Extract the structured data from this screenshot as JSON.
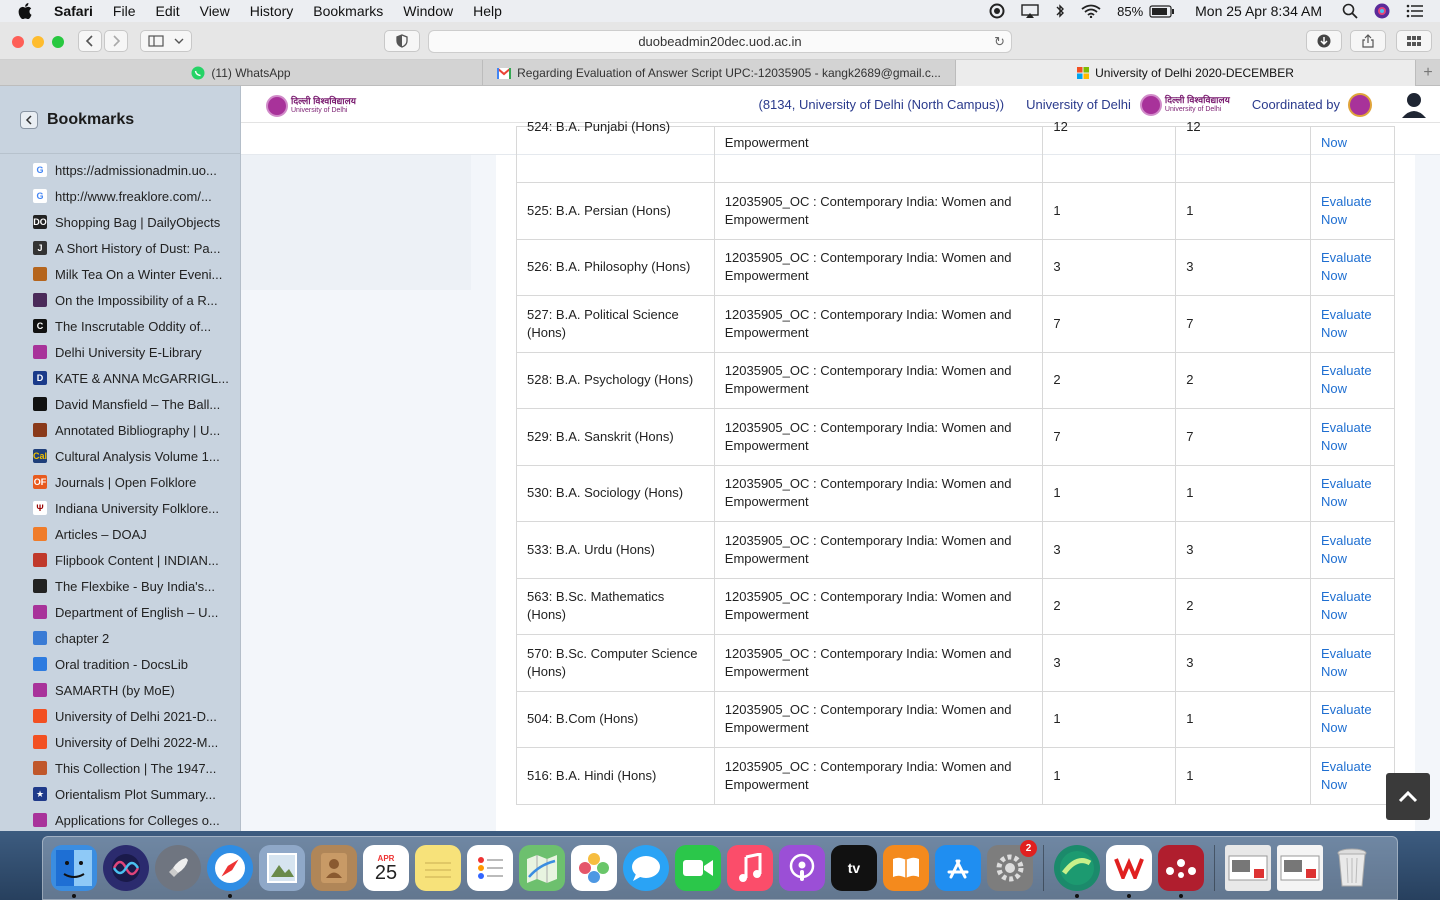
{
  "menubar": {
    "app": "Safari",
    "items": [
      "File",
      "Edit",
      "View",
      "History",
      "Bookmarks",
      "Window",
      "Help"
    ],
    "battery": "85%",
    "datetime": "Mon 25 Apr  8:34 AM"
  },
  "toolbar": {
    "url": "duobeadmin20dec.uod.ac.in"
  },
  "tabs": [
    {
      "label": "(11) WhatsApp",
      "icon": "whatsapp-icon"
    },
    {
      "label": "Regarding Evaluation of Answer Script UPC:-12035905 - kangk2689@gmail.c...",
      "icon": "gmail-icon"
    },
    {
      "label": "University of Delhi 2020-DECEMBER",
      "icon": "microsoft-icon"
    }
  ],
  "sidebar": {
    "title": "Bookmarks",
    "items": [
      {
        "label": "https://admissionadmin.uo...",
        "fav": "G",
        "color": "#ffffff",
        "fg": "#4285f4"
      },
      {
        "label": "http://www.freaklore.com/...",
        "fav": "G",
        "color": "#ffffff",
        "fg": "#4285f4"
      },
      {
        "label": "Shopping Bag | DailyObjects",
        "fav": "DO",
        "color": "#222222",
        "fg": "#ffffff"
      },
      {
        "label": "A Short History of Dust: Pa...",
        "fav": "J",
        "color": "#333333",
        "fg": "#ffffff"
      },
      {
        "label": "Milk Tea On a Winter Eveni...",
        "fav": "",
        "color": "#b5651d",
        "fg": "#ffffff"
      },
      {
        "label": "On the Impossibility of a R...",
        "fav": "",
        "color": "#4a2a5a",
        "fg": "#ffffff"
      },
      {
        "label": "The Inscrutable Oddity of...",
        "fav": "C",
        "color": "#111111",
        "fg": "#ffffff"
      },
      {
        "label": "Delhi University E-Library",
        "fav": "",
        "color": "#a8329a",
        "fg": "#ffffff"
      },
      {
        "label": "KATE & ANNA McGARRIGL...",
        "fav": "D",
        "color": "#1a3a8a",
        "fg": "#ffffff"
      },
      {
        "label": "David Mansfield – The Ball...",
        "fav": "",
        "color": "#111111",
        "fg": "#ffffff"
      },
      {
        "label": "Annotated Bibliography | U...",
        "fav": "",
        "color": "#8a3a1a",
        "fg": "#ffffff"
      },
      {
        "label": "Cultural Analysis Volume 1...",
        "fav": "Cal",
        "color": "#1f3f7a",
        "fg": "#f2c200"
      },
      {
        "label": "Journals | Open Folklore",
        "fav": "OF",
        "color": "#e85a1e",
        "fg": "#ffffff"
      },
      {
        "label": "Indiana University Folklore...",
        "fav": "Ψ",
        "color": "#ffffff",
        "fg": "#990000"
      },
      {
        "label": "Articles – DOAJ",
        "fav": "",
        "color": "#f07c2a",
        "fg": "#ffffff"
      },
      {
        "label": "Flipbook Content | INDIAN...",
        "fav": "",
        "color": "#c0392b",
        "fg": "#ffffff"
      },
      {
        "label": "The Flexbike - Buy India's...",
        "fav": "",
        "color": "#222222",
        "fg": "#ffffff"
      },
      {
        "label": "Department of English – U...",
        "fav": "",
        "color": "#a8329a",
        "fg": "#ffffff"
      },
      {
        "label": "chapter 2",
        "fav": "",
        "color": "#3a7bd5",
        "fg": "#ffffff"
      },
      {
        "label": "Oral tradition - DocsLib",
        "fav": "",
        "color": "#2d7be0",
        "fg": "#ffffff"
      },
      {
        "label": "SAMARTH (by MoE)",
        "fav": "",
        "color": "#a8329a",
        "fg": "#ffffff"
      },
      {
        "label": "University of Delhi 2021-D...",
        "fav": "",
        "color": "#f25022",
        "fg": "#ffffff"
      },
      {
        "label": "University of Delhi 2022-M...",
        "fav": "",
        "color": "#f25022",
        "fg": "#ffffff"
      },
      {
        "label": "This Collection | The 1947...",
        "fav": "",
        "color": "#c0572b",
        "fg": "#ffffff"
      },
      {
        "label": "Orientalism Plot Summary...",
        "fav": "★",
        "color": "#1f3a8a",
        "fg": "#ffffff"
      },
      {
        "label": "Applications for Colleges o...",
        "fav": "",
        "color": "#a8329a",
        "fg": "#ffffff"
      }
    ]
  },
  "header": {
    "logo_hi": "दिल्ली विश्वविद्यालय",
    "logo_en": "University of Delhi",
    "campus": "(8134, University of Delhi (North Campus))",
    "university": "University of Delhi",
    "coordinated": "Coordinated by"
  },
  "table": {
    "partial_row": {
      "course": "524: B.A. Punjabi (Hons)",
      "paper": "Empowerment",
      "a": "12",
      "b": "12",
      "action": "Now"
    },
    "rows": [
      {
        "course": "525: B.A. Persian (Hons)",
        "paper": "12035905_OC : Contemporary India: Women and Empowerment",
        "a": "1",
        "b": "1",
        "action1": "Evaluate",
        "action2": "Now"
      },
      {
        "course": "526: B.A. Philosophy (Hons)",
        "paper": "12035905_OC : Contemporary India: Women and Empowerment",
        "a": "3",
        "b": "3",
        "action1": "Evaluate",
        "action2": "Now"
      },
      {
        "course": "527: B.A. Political Science (Hons)",
        "paper": "12035905_OC : Contemporary India: Women and Empowerment",
        "a": "7",
        "b": "7",
        "action1": "Evaluate",
        "action2": "Now"
      },
      {
        "course": "528: B.A. Psychology (Hons)",
        "paper": "12035905_OC : Contemporary India: Women and Empowerment",
        "a": "2",
        "b": "2",
        "action1": "Evaluate",
        "action2": "Now"
      },
      {
        "course": "529: B.A. Sanskrit (Hons)",
        "paper": "12035905_OC : Contemporary India: Women and Empowerment",
        "a": "7",
        "b": "7",
        "action1": "Evaluate",
        "action2": "Now"
      },
      {
        "course": "530: B.A. Sociology (Hons)",
        "paper": "12035905_OC : Contemporary India: Women and Empowerment",
        "a": "1",
        "b": "1",
        "action1": "Evaluate",
        "action2": "Now"
      },
      {
        "course": "533: B.A. Urdu (Hons)",
        "paper": "12035905_OC : Contemporary India: Women and Empowerment",
        "a": "3",
        "b": "3",
        "action1": "Evaluate",
        "action2": "Now"
      },
      {
        "course": "563: B.Sc. Mathematics (Hons)",
        "paper": "12035905_OC : Contemporary India: Women and Empowerment",
        "a": "2",
        "b": "2",
        "action1": "Evaluate",
        "action2": "Now"
      },
      {
        "course": "570: B.Sc. Computer Science (Hons)",
        "paper": "12035905_OC : Contemporary India: Women and Empowerment",
        "a": "3",
        "b": "3",
        "action1": "Evaluate",
        "action2": "Now"
      },
      {
        "course": "504: B.Com (Hons)",
        "paper": "12035905_OC : Contemporary India: Women and Empowerment",
        "a": "1",
        "b": "1",
        "action1": "Evaluate",
        "action2": "Now"
      },
      {
        "course": "516: B.A. Hindi (Hons)",
        "paper": "12035905_OC : Contemporary India: Women and Empowerment",
        "a": "1",
        "b": "1",
        "action1": "Evaluate",
        "action2": "Now"
      }
    ]
  },
  "dock": {
    "calendar_month": "APR",
    "calendar_day": "25",
    "appletv_label": "tv",
    "settings_badge": "2",
    "icons": [
      {
        "name": "finder-icon",
        "color": "#3b8de0"
      },
      {
        "name": "siri-icon",
        "color": "#2b2b6e"
      },
      {
        "name": "launchpad-icon",
        "color": "#6f7580"
      },
      {
        "name": "safari-icon",
        "color": "#2f8de4"
      },
      {
        "name": "preview-icon",
        "color": "#8fa8c8"
      },
      {
        "name": "contacts-icon",
        "color": "#b08658"
      },
      {
        "name": "calendar-icon",
        "color": "#ffffff"
      },
      {
        "name": "notes-icon",
        "color": "#f7e27a"
      },
      {
        "name": "reminders-icon",
        "color": "#ffffff"
      },
      {
        "name": "maps-icon",
        "color": "#6dc06e"
      },
      {
        "name": "photos-icon",
        "color": "#ffffff"
      },
      {
        "name": "messages-icon",
        "color": "#2aa3f5"
      },
      {
        "name": "facetime-icon",
        "color": "#2bc74a"
      },
      {
        "name": "music-icon",
        "color": "#fb4d6a"
      },
      {
        "name": "podcasts-icon",
        "color": "#9b4fd6"
      },
      {
        "name": "appletv-icon",
        "color": "#111111"
      },
      {
        "name": "books-icon",
        "color": "#f48a1d"
      },
      {
        "name": "appstore-icon",
        "color": "#1f8ef1"
      },
      {
        "name": "system-preferences-icon",
        "color": "#7d7d7d"
      }
    ],
    "apps2": [
      {
        "name": "browser-icon",
        "color": "#1b8a6b"
      },
      {
        "name": "wps-office-icon",
        "color": "#ffffff"
      },
      {
        "name": "mendeley-icon",
        "color": "#b01e2e"
      }
    ]
  }
}
